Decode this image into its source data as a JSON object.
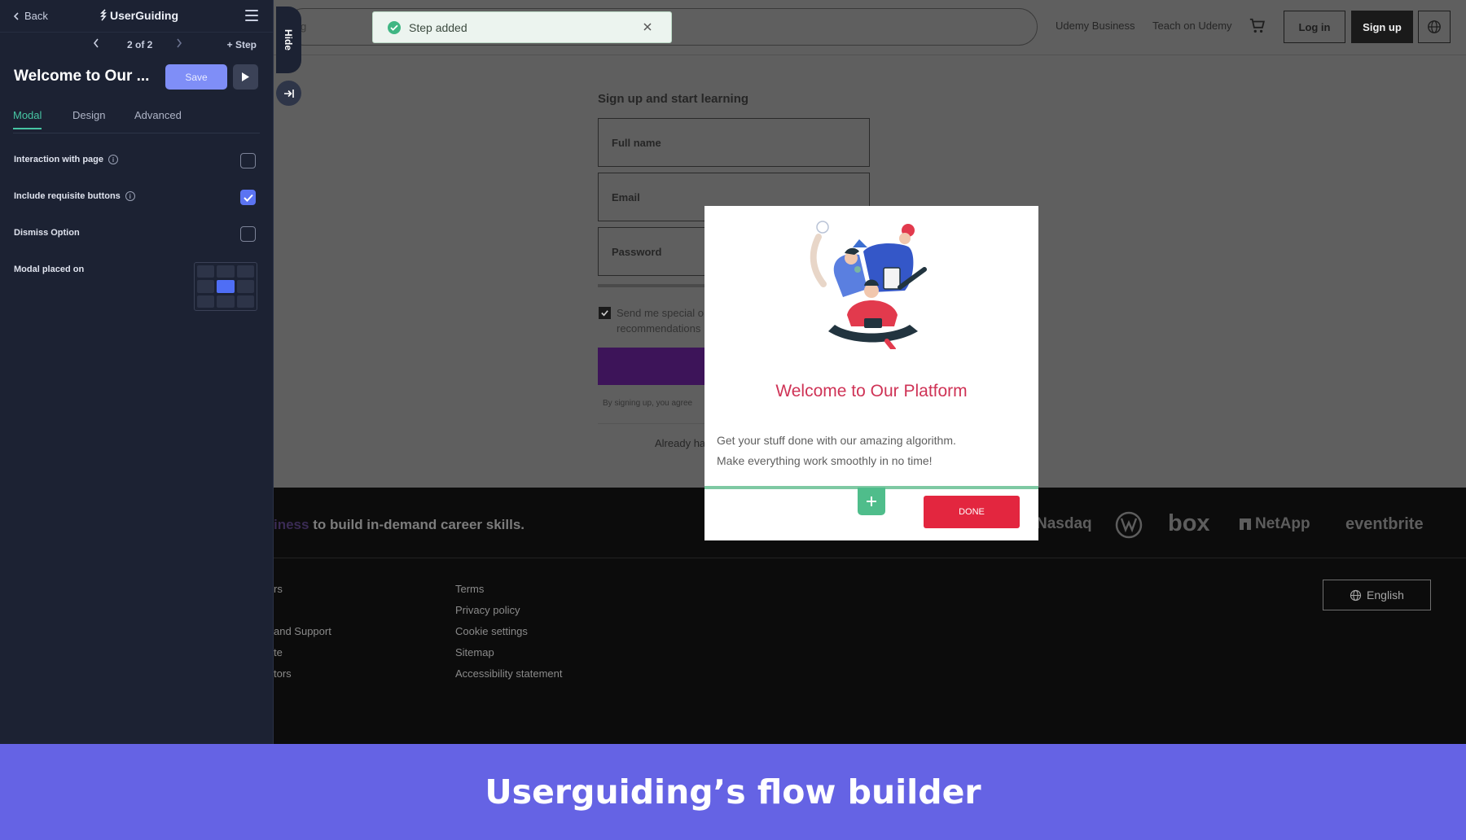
{
  "builder": {
    "back_label": "Back",
    "logo_text": "UserGuiding",
    "step_counter": "2 of 2",
    "add_step_label": "+ Step",
    "flow_title": "Welcome to Our ...",
    "save_label": "Save",
    "tabs": [
      {
        "label": "Modal",
        "active": true
      },
      {
        "label": "Design",
        "active": false
      },
      {
        "label": "Advanced",
        "active": false
      }
    ],
    "options": [
      {
        "label": "Interaction with page",
        "info": true,
        "checked": false
      },
      {
        "label": "Include requisite buttons",
        "info": true,
        "checked": true
      },
      {
        "label": "Dismiss Option",
        "info": false,
        "checked": false
      }
    ],
    "placement_label": "Modal placed on",
    "placement_selected": "center",
    "hide_label": "Hide"
  },
  "toast": {
    "message": "Step added"
  },
  "site": {
    "search_placeholder_fragment": "g",
    "nav_links": [
      "Udemy Business",
      "Teach on Udemy"
    ],
    "login_label": "Log in",
    "signup_label": "Sign up",
    "form_title": "Sign up and start learning",
    "fields": [
      "Full name",
      "Email",
      "Password"
    ],
    "consent_text": "Send me special o\nrecommendations",
    "terms_text": "By signing up, you agree",
    "already_text": "Already ha",
    "tagline_highlight": "iness",
    "tagline_rest": " to build in-demand career skills.",
    "partner_logos": [
      "Nasdaq",
      "box",
      "NetApp",
      "eventbrite"
    ],
    "footer_col1": [
      "rs",
      "and Support",
      "te",
      "tors"
    ],
    "footer_col2": [
      "Terms",
      "Privacy policy",
      "Cookie settings",
      "Sitemap",
      "Accessibility statement"
    ],
    "language_label": "English"
  },
  "modal": {
    "title": "Welcome to Our Platform",
    "body_line1": "Get your stuff done with our amazing algorithm.",
    "body_line2": "Make everything work smoothly in no time!",
    "done_label": "DONE"
  },
  "caption": {
    "text": "Userguiding’s flow builder"
  },
  "colors": {
    "panel_bg": "#1c2233",
    "accent_green": "#47c6a4",
    "save_blue": "#7f8ef7",
    "modal_title": "#cf3356",
    "done_red": "#e3263f",
    "caption_bg": "#6563e4"
  }
}
